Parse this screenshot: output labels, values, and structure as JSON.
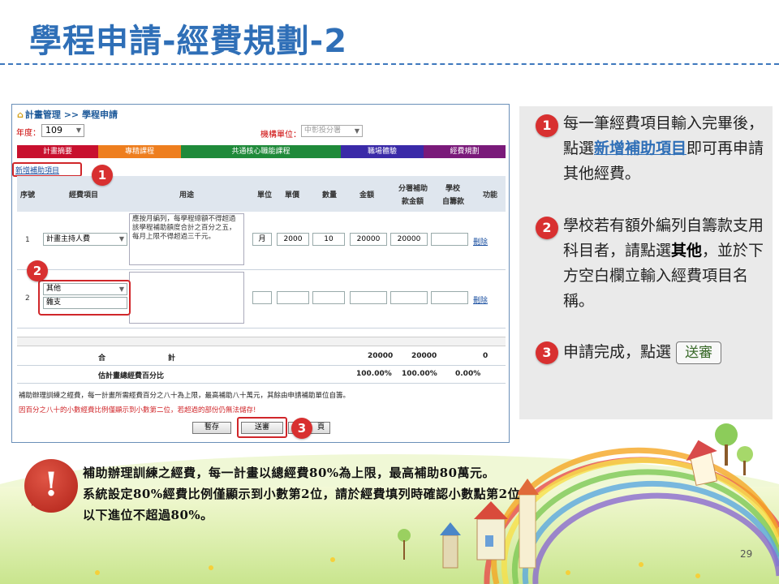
{
  "slide": {
    "title": "學程申請-經費規劃-2",
    "page_number": "29"
  },
  "screen": {
    "breadcrumb": "計畫管理 >> 學程申請",
    "year_label": "年度：",
    "year_value": "109",
    "org_label": "機構單位：",
    "org_value": "中彰投分署",
    "tabs": [
      {
        "label": "計畫摘要",
        "color": "#c8102e"
      },
      {
        "label": "專精課程",
        "color": "#ee7e1e"
      },
      {
        "label": "共通核心職能課程",
        "color": "#1f8a3a"
      },
      {
        "label": "職場體驗",
        "color": "#3a2aa8"
      },
      {
        "label": "經費規劃",
        "color": "#7a1a7a"
      }
    ],
    "add_link": "新增補助項目",
    "headers": {
      "seq": "序號",
      "item": "經費項目",
      "usage": "用途",
      "unit": "單位",
      "price": "單價",
      "qty": "數量",
      "amount": "金額",
      "subsidy_1": "分署補助",
      "subsidy_2": "款金額",
      "school_1": "學校",
      "school_2": "自籌款",
      "action": "功能"
    },
    "rows": [
      {
        "seq": "1",
        "item": "計畫主持人費",
        "usage": "應按月編列，每學程總額不得超過該學程補助額度合計之百分之五，每月上限不得超過三千元。",
        "unit": "月",
        "price": "2000",
        "qty": "10",
        "amount": "20000",
        "subsidy": "20000",
        "school": "",
        "action": "刪除"
      },
      {
        "seq": "2",
        "item": "其他",
        "item_extra": "雜支",
        "usage": "",
        "unit": "",
        "price": "",
        "qty": "",
        "amount": "",
        "subsidy": "",
        "school": "",
        "action": "刪除"
      }
    ],
    "total_label_a": "合",
    "total_label_b": "計",
    "total_amount": "20000",
    "total_subsidy": "20000",
    "total_school": "0",
    "pct_label": "估計畫總經費百分比",
    "pct_amount": "100.00%",
    "pct_subsidy": "100.00%",
    "pct_school": "0.00%",
    "note_1": "補助辦理訓練之經費，每一計畫所需經費百分之八十為上限，最高補助八十萬元，其餘由申請補助單位自籌。",
    "note_2": "因百分之八十的小數經費比例僅顯示到小數第二位，若超過的部份仍無法儲存!",
    "btn_save": "暫存",
    "btn_send": "送審",
    "btn_back": "返回",
    "btn_back_visible": "頁"
  },
  "callouts": {
    "badge_1": "1",
    "badge_2": "2",
    "badge_3": "3"
  },
  "steps": [
    {
      "num": "1",
      "pre": "每一筆經費項目輸入完畢後，點選",
      "link": "新增補助項目",
      "post": "即可再申請其他經費。"
    },
    {
      "num": "2",
      "pre": "學校若有額外編列自籌款支用科目者，請點選",
      "bold": "其他",
      "post": "，並於下方空白欄立輸入經費項目名稱。"
    },
    {
      "num": "3",
      "pre": "申請完成，點選",
      "button": "送審"
    }
  ],
  "warning": {
    "icon": "exclamation-icon",
    "line_1": "補助辦理訓練之經費，每一計畫以總經費80%為上限，最高補助80萬元。",
    "line_2": "系統設定80%經費比例僅顯示到小數第2位，請於經費填列時確認小數點第2位",
    "line_3": "以下進位不超過80%。"
  }
}
